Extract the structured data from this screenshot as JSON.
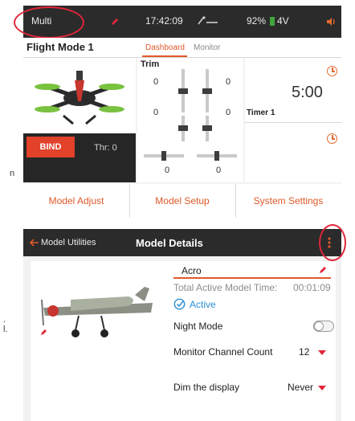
{
  "page_letters": {
    "a": "n",
    "b": ".",
    "c": "l."
  },
  "dashboard": {
    "model_name": "Multi",
    "clock": "17:42:09",
    "battery_percent": "92%",
    "voltage": "4V",
    "flight_mode": "Flight Mode 1",
    "tabs": [
      {
        "label": "Dashboard",
        "active": true
      },
      {
        "label": "Monitor",
        "active": false
      }
    ],
    "bind_label": "BIND",
    "throttle_label": "Thr: 0",
    "trim": {
      "title": "Trim",
      "values_top": [
        "0",
        "0"
      ],
      "values_middle": [
        "0",
        "0"
      ],
      "values_bottom": [
        "0",
        "0"
      ]
    },
    "timer": {
      "value": "5:00",
      "name": "Timer 1"
    },
    "buttons": [
      "Model Adjust",
      "Model Setup",
      "System Settings"
    ],
    "icons": [
      "pencil-icon",
      "servo-icon",
      "battery-icon",
      "speaker-icon",
      "clock-icon"
    ],
    "accent": "#e0592a",
    "highlight": "#e0263a"
  },
  "model_details": {
    "back_label": "Model Utilities",
    "title": "Model Details",
    "model_name_field": "Acro",
    "active_time_label": "Total Active Model Time:",
    "active_time_value": "00:01:09",
    "active_label": "Active",
    "night_mode_label": "Night Mode",
    "night_mode_on": false,
    "channel_count_label": "Monitor Channel Count",
    "channel_count_value": "12",
    "dim_label": "Dim the display",
    "dim_value": "Never",
    "active_color": "#2a8fd6"
  }
}
